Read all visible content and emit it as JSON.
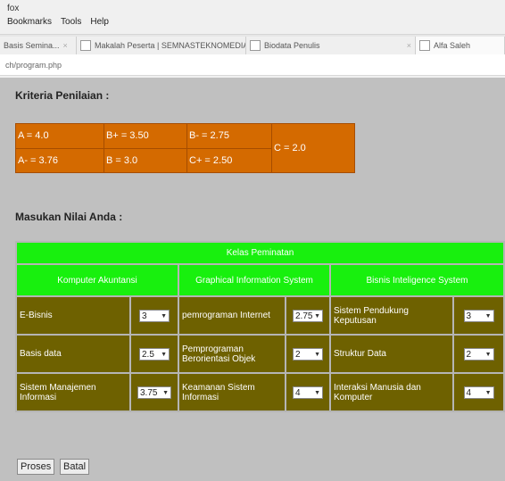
{
  "browser": {
    "title": "fox",
    "menu": [
      "Bookmarks",
      "Tools",
      "Help"
    ],
    "tabs": [
      {
        "label": "Basis Semina...",
        "close": "×"
      },
      {
        "label": "Makalah Peserta | SEMNASTEKNOMEDIA...",
        "close": "×"
      },
      {
        "label": "Biodata Penulis",
        "close": "×"
      },
      {
        "label": "Alfa Saleh",
        "close": ""
      }
    ],
    "url": "ch/program.php"
  },
  "page": {
    "kriteria_title": "Kriteria Penilaian :",
    "kriteria": {
      "row1": [
        "A = 4.0",
        "B+ = 3.50",
        "B- = 2.75"
      ],
      "row2": [
        "A- = 3.76",
        "B = 3.0",
        "C+ = 2.50"
      ],
      "c": "C = 2.0"
    },
    "input_title": "Masukan Nilai Anda :",
    "table": {
      "header": "Kelas Peminatan",
      "groups": [
        "Komputer Akuntansi",
        "Graphical Information System",
        "Bisnis Inteligence System"
      ],
      "rows": [
        [
          {
            "label": "E-Bisnis",
            "value": "3"
          },
          {
            "label": "pemrograman Internet",
            "value": "2.75"
          },
          {
            "label": "Sistem Pendukung Keputusan",
            "value": "3"
          }
        ],
        [
          {
            "label": "Basis data",
            "value": "2.5"
          },
          {
            "label": "Pemprograman Berorientasi Objek",
            "value": "2"
          },
          {
            "label": "Struktur Data",
            "value": "2"
          }
        ],
        [
          {
            "label": "Sistem Manajemen Informasi",
            "value": "3.75"
          },
          {
            "label": "Keamanan Sistem Informasi",
            "value": "4"
          },
          {
            "label": "Interaksi Manusia dan Komputer",
            "value": "4"
          }
        ]
      ]
    },
    "buttons": {
      "proses": "Proses",
      "batal": "Batal"
    }
  }
}
